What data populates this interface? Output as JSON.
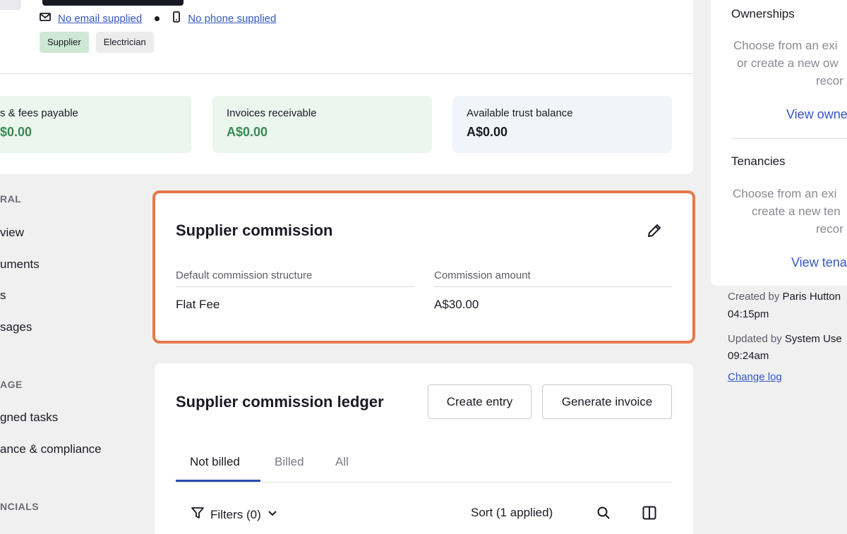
{
  "header": {
    "email": "No email supplied",
    "phone": "No phone supplied",
    "tags": [
      "Supplier",
      "Electrician"
    ],
    "stats": [
      {
        "label": "s & fees payable",
        "value": "$0.00"
      },
      {
        "label": "Invoices receivable",
        "value": "A$0.00"
      },
      {
        "label": "Available trust balance",
        "value": "A$0.00"
      }
    ]
  },
  "nav": {
    "section_general": "RAL",
    "items_general": [
      "view",
      "uments",
      "s",
      "sages"
    ],
    "section_manage": "AGE",
    "items_manage": [
      "gned tasks",
      "ance & compliance"
    ],
    "section_financials": "NCIALS"
  },
  "commission": {
    "title": "Supplier commission",
    "structure_label": "Default commission structure",
    "structure_value": "Flat Fee",
    "amount_label": "Commission amount",
    "amount_value": "A$30.00"
  },
  "ledger": {
    "title": "Supplier commission ledger",
    "create_label": "Create entry",
    "generate_label": "Generate invoice",
    "tabs": [
      "Not billed",
      "Billed",
      "All"
    ],
    "filters_label": "Filters (0)",
    "sort_label": "Sort (1 applied)"
  },
  "right": {
    "ownerships_title": "Ownerships",
    "ownerships_text1": "Choose from an exi",
    "ownerships_text2": "or create a new ow",
    "ownerships_text3": "recor",
    "ownerships_link": "View owne",
    "tenancies_title": "Tenancies",
    "tenancies_text1": "Choose from an exi",
    "tenancies_text2": "create a new ten",
    "tenancies_text3": "recor",
    "tenancies_link": "View tena",
    "created_prefix": "Created by",
    "created_by": "Paris Hutton",
    "created_time": "04:15pm",
    "updated_prefix": "Updated by",
    "updated_by": "System Use",
    "updated_time": "09:24am",
    "change_log": "Change log"
  }
}
